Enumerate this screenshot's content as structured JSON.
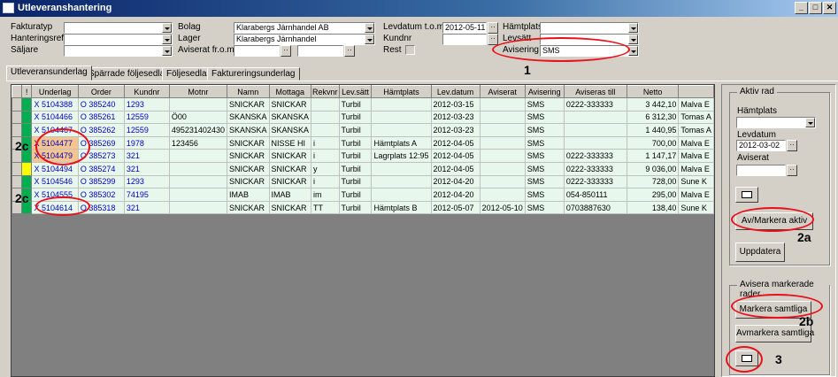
{
  "window": {
    "title": "Utleveranshantering"
  },
  "filters": {
    "fakturatyp": {
      "label": "Fakturatyp",
      "value": ""
    },
    "hanteringsref": {
      "label": "Hanteringsref",
      "value": ""
    },
    "saljare": {
      "label": "Säljare",
      "value": ""
    },
    "bolag": {
      "label": "Bolag",
      "value": "Klarabergs  Järnhandel AB"
    },
    "lager": {
      "label": "Lager",
      "value": "Klarabergs Järnhandel"
    },
    "aviserat_from": {
      "label": "Aviserat fr.o.m",
      "value": ""
    },
    "aviserat_tom": {
      "value": ""
    },
    "levdatum_tom": {
      "label": "Levdatum t.o.m",
      "value": "2012-05-11"
    },
    "kundnr": {
      "label": "Kundnr",
      "value": ""
    },
    "rest": {
      "label": "Rest"
    },
    "hamtplats": {
      "label": "Hämtplats",
      "value": ""
    },
    "levsatt": {
      "label": "Levsätt",
      "value": ""
    },
    "avisering": {
      "label": "Avisering",
      "value": "SMS"
    }
  },
  "tabs": [
    "Utleveransunderlag",
    "Spärrade följesedlar",
    "Följesedlar",
    "Faktureringsunderlag"
  ],
  "grid": {
    "columns": [
      "!",
      "Underlag",
      "Order",
      "Kundnr",
      "Motnr",
      "Namn",
      "Mottaga",
      "Rekvnr",
      "Lev.sätt",
      "Hämtplats",
      "Lev.datum",
      "Aviserat",
      "Avisering",
      "Aviseras till",
      "Netto",
      ""
    ],
    "rows": [
      {
        "ind": "",
        "mark": "X",
        "underlag": "5104388",
        "o": "O",
        "order": "385240",
        "kundnr": "1293",
        "motnr": "",
        "namn": "SNICKAR",
        "mottaga": "SNICKAR",
        "rekvnr": "",
        "levsatt": "Turbil",
        "hamtplats": "",
        "levdatum": "2012-03-15",
        "aviserat": "",
        "avisering": "SMS",
        "aviseras_till": "0222-333333",
        "netto": "3 442,10",
        "extra": "Malva E"
      },
      {
        "ind": "",
        "mark": "X",
        "underlag": "5104466",
        "o": "O",
        "order": "385261",
        "kundnr": "12559",
        "motnr": "Ö00",
        "namn": "SKANSKA",
        "mottaga": "SKANSKA",
        "rekvnr": "",
        "levsatt": "Turbil",
        "hamtplats": "",
        "levdatum": "2012-03-23",
        "aviserat": "",
        "avisering": "SMS",
        "aviseras_till": "",
        "netto": "6 312,30",
        "extra": "Tomas A"
      },
      {
        "ind": "",
        "mark": "X",
        "underlag": "5104467",
        "o": "O",
        "order": "385262",
        "kundnr": "12559",
        "motnr": "495231402430",
        "namn": "SKANSKA",
        "mottaga": "SKANSKA",
        "rekvnr": "",
        "levsatt": "Turbil",
        "hamtplats": "",
        "levdatum": "2012-03-23",
        "aviserat": "",
        "avisering": "SMS",
        "aviseras_till": "",
        "netto": "1 440,95",
        "extra": "Tomas A"
      },
      {
        "ind": "",
        "mark": "X",
        "underlag": "5104477",
        "o": "O",
        "order": "385269",
        "kundnr": "1978",
        "motnr": "123456",
        "namn": "SNICKAR",
        "mottaga": "NISSE HI",
        "rekvnr": "i",
        "levsatt": "Turbil",
        "hamtplats": "Hämtplats A",
        "levdatum": "2012-04-05",
        "aviserat": "",
        "avisering": "SMS",
        "aviseras_till": "",
        "netto": "700,00",
        "extra": "Malva E"
      },
      {
        "ind": "",
        "mark": "X",
        "underlag": "5104479",
        "o": "O",
        "order": "385273",
        "kundnr": "321",
        "motnr": "",
        "namn": "SNICKAR",
        "mottaga": "SNICKAR",
        "rekvnr": "i",
        "levsatt": "Turbil",
        "hamtplats": "Lagrplats 12:95",
        "levdatum": "2012-04-05",
        "aviserat": "",
        "avisering": "SMS",
        "aviseras_till": "0222-333333",
        "netto": "1 147,17",
        "extra": "Malva E"
      },
      {
        "ind": "yellow",
        "mark": "X",
        "underlag": "5104494",
        "o": "O",
        "order": "385274",
        "kundnr": "321",
        "motnr": "",
        "namn": "SNICKAR",
        "mottaga": "SNICKAR",
        "rekvnr": "y",
        "levsatt": "Turbil",
        "hamtplats": "",
        "levdatum": "2012-04-05",
        "aviserat": "",
        "avisering": "SMS",
        "aviseras_till": "0222-333333",
        "netto": "9 036,00",
        "extra": "Malva E"
      },
      {
        "ind": "",
        "mark": "X",
        "underlag": "5104546",
        "o": "O",
        "order": "385299",
        "kundnr": "1293",
        "motnr": "",
        "namn": "SNICKAR",
        "mottaga": "SNICKAR",
        "rekvnr": "i",
        "levsatt": "Turbil",
        "hamtplats": "",
        "levdatum": "2012-04-20",
        "aviserat": "",
        "avisering": "SMS",
        "aviseras_till": "0222-333333",
        "netto": "728,00",
        "extra": "Sune K"
      },
      {
        "ind": "",
        "mark": "X",
        "underlag": "5104555",
        "o": "O",
        "order": "385302",
        "kundnr": "74195",
        "motnr": "",
        "namn": "IMAB",
        "mottaga": "IMAB",
        "rekvnr": "im",
        "levsatt": "Turbil",
        "hamtplats": "",
        "levdatum": "2012-04-20",
        "aviserat": "",
        "avisering": "SMS",
        "aviseras_till": "054-850111",
        "netto": "295,00",
        "extra": "Malva E"
      },
      {
        "ind": "",
        "mark": "X",
        "underlag": "5104614",
        "o": "O",
        "order": "385318",
        "kundnr": "321",
        "motnr": "",
        "namn": "SNICKAR",
        "mottaga": "SNICKAR",
        "rekvnr": "TT",
        "levsatt": "Turbil",
        "hamtplats": "Hämtplats B",
        "levdatum": "2012-05-07",
        "aviserat": "2012-05-10",
        "avisering": "SMS",
        "aviseras_till": "0703887630",
        "netto": "138,40",
        "extra": "Sune K"
      }
    ]
  },
  "side": {
    "aktiv_rad": {
      "title": "Aktiv rad",
      "hamtplats_label": "Hämtplats",
      "hamtplats_value": "",
      "levdatum_label": "Levdatum",
      "levdatum_value": "2012-03-02",
      "aviserat_label": "Aviserat",
      "aviserat_value": "",
      "av_markera_aktiv": "Av/Markera aktiv",
      "uppdatera": "Uppdatera"
    },
    "avisera": {
      "title": "Avisera markerade rader",
      "markera_samtliga": "Markera samtliga",
      "avmarkera_samtliga": "Avmarkera samtliga"
    }
  },
  "annotations": {
    "a1": "1",
    "a2a": "2a",
    "a2b": "2b",
    "a2c_1": "2c",
    "a2c_2": "2c",
    "a3": "3"
  },
  "colors": {
    "row_bg": "#e8f7ec",
    "link_blue": "#0000c0",
    "ring": "#e8101a",
    "indicator_green": "#00b050",
    "indicator_yellow": "#ffff00"
  }
}
